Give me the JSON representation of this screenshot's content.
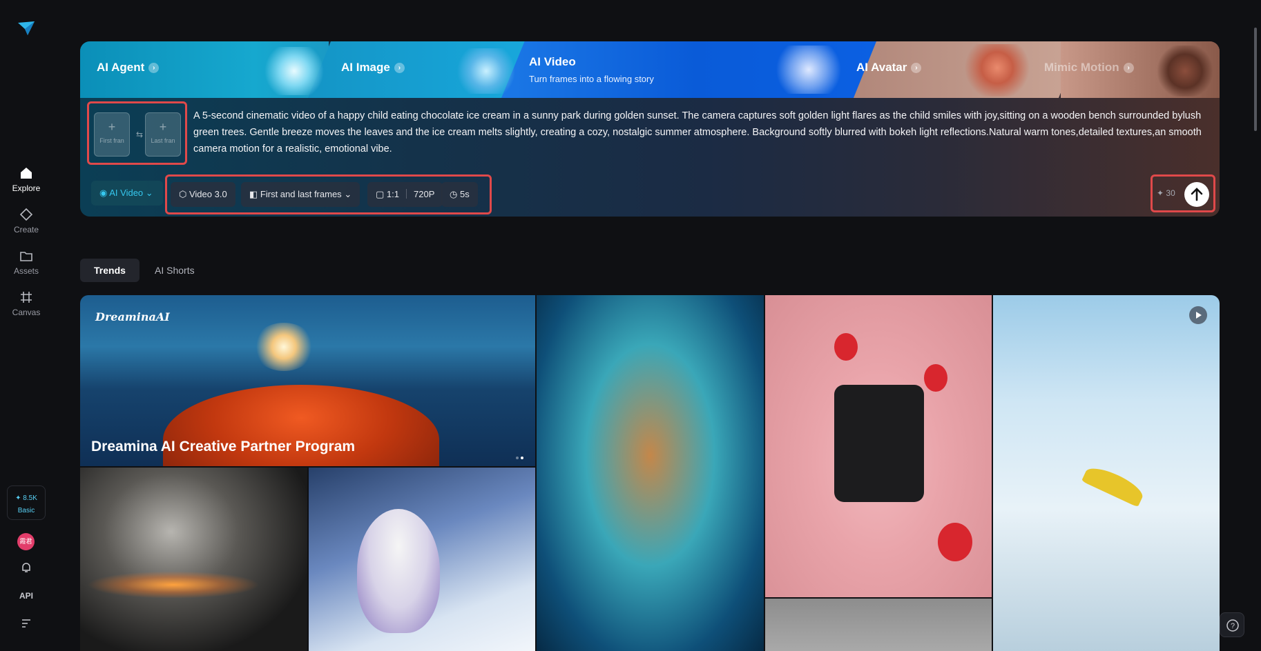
{
  "sidebar": {
    "logo_icon": "dreamina-logo-icon",
    "items": [
      {
        "label": "Explore",
        "icon": "home-icon",
        "active": true
      },
      {
        "label": "Create",
        "icon": "diamond-icon",
        "active": false
      },
      {
        "label": "Assets",
        "icon": "folder-icon",
        "active": false
      },
      {
        "label": "Canvas",
        "icon": "canvas-icon",
        "active": false
      }
    ],
    "credits": {
      "amount": "8.5K",
      "plan": "Basic"
    },
    "avatar_text": "霞君",
    "api_label": "API"
  },
  "hero": {
    "tabs": [
      {
        "label": "AI Agent"
      },
      {
        "label": "AI Image"
      },
      {
        "label": "AI Video",
        "subtitle": "Turn frames into a flowing story",
        "active": true
      },
      {
        "label": "AI Avatar"
      },
      {
        "label": "Mimic Motion"
      }
    ],
    "frames": {
      "first_label": "First fran",
      "last_label": "Last fran"
    },
    "prompt": "A 5-second cinematic video of a happy child eating chocolate ice cream in a sunny park during golden sunset. The camera captures soft golden light flares as the child smiles with joy,sitting on a wooden bench surrounded bylush green trees. Gentle breeze moves the leaves and the ice cream melts slightly, creating a cozy, nostalgic summer atmosphere. Background softly blurred with bokeh light reflections.Natural warm tones,detailed textures,an smooth camera motion for a realistic, emotional vibe.",
    "mode": "AI Video",
    "options": {
      "model": "Video 3.0",
      "frames_mode": "First and last frames",
      "ratio": "1:1",
      "resolution": "720P",
      "duration": "5s"
    },
    "cost": "30"
  },
  "feed": {
    "tabs": [
      {
        "label": "Trends",
        "active": true
      },
      {
        "label": "AI Shorts",
        "active": false
      }
    ],
    "banner": {
      "brand": "DreaminaAI",
      "title": "Dreamina AI Creative Partner Program"
    },
    "colors": {
      "accent": "#36c8ef",
      "highlight_border": "#e0494a"
    }
  }
}
